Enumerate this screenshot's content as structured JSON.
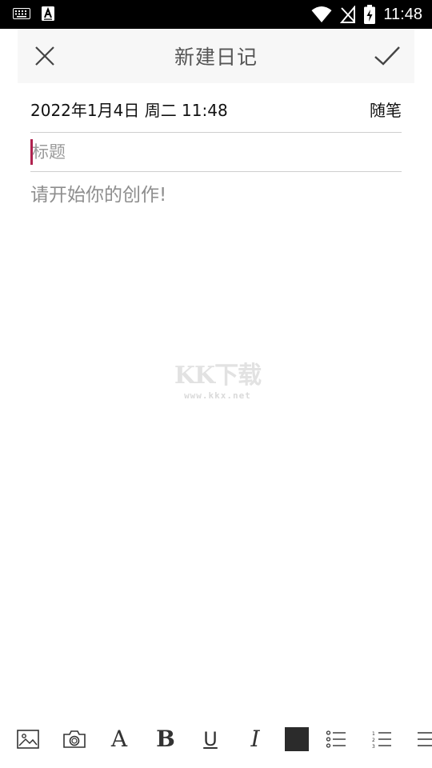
{
  "status_bar": {
    "time": "11:48",
    "icons": [
      "keyboard-icon",
      "text-a-icon",
      "wifi-icon",
      "no-sim-icon",
      "battery-charging-icon"
    ]
  },
  "header": {
    "title": "新建日记",
    "close_icon": "close-icon",
    "confirm_icon": "check-icon"
  },
  "entry": {
    "date": "2022年1月4日  周二  11:48",
    "category": "随笔",
    "title_placeholder": "标题",
    "body_placeholder": "请开始你的创作!"
  },
  "watermark": {
    "logo_text": "KK下载",
    "url": "www.kkx.net"
  },
  "toolbar": {
    "items": [
      "image-icon",
      "camera-icon",
      "font-icon",
      "bold-icon",
      "underline-icon",
      "italic-icon",
      "text-color-swatch",
      "bullet-list-icon",
      "numbered-list-icon",
      "align-icon"
    ],
    "font_letter": "A",
    "bold_letter": "B",
    "underline_letter": "U",
    "italic_letter": "I",
    "text_color": "#2b2b2b"
  }
}
